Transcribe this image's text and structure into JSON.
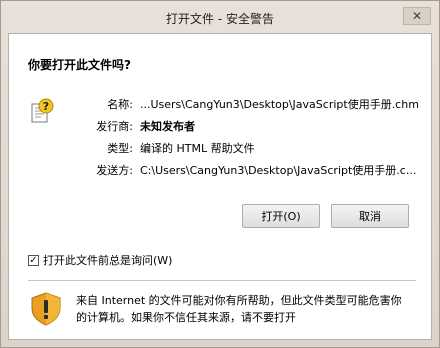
{
  "window": {
    "title": "打开文件 - 安全警告",
    "close_glyph": "✕"
  },
  "dialog": {
    "question": "你要打开此文件吗?",
    "fields": [
      {
        "label": "名称:",
        "value": "...Users\\CangYun3\\Desktop\\JavaScript使用手册.chm"
      },
      {
        "label": "发行商:",
        "value": "未知发布者"
      },
      {
        "label": "类型:",
        "value": "编译的 HTML 帮助文件"
      },
      {
        "label": "发送方:",
        "value": "C:\\Users\\CangYun3\\Desktop\\JavaScript使用手册.c..."
      }
    ],
    "buttons": {
      "open": "打开(O)",
      "cancel": "取消"
    },
    "checkbox": {
      "label": "打开此文件前总是询问(W)",
      "checked": true,
      "mark": "✓"
    },
    "warning": "来自 Internet 的文件可能对你有所帮助，但此文件类型可能危害你的计算机。如果你不信任其来源，请不要打开"
  },
  "icons": {
    "file": "chm-help-file-icon",
    "warning": "shield-warning-icon",
    "close": "close-icon"
  },
  "colors": {
    "shield_orange": "#e8a020",
    "shield_dark": "#b56b0a"
  }
}
